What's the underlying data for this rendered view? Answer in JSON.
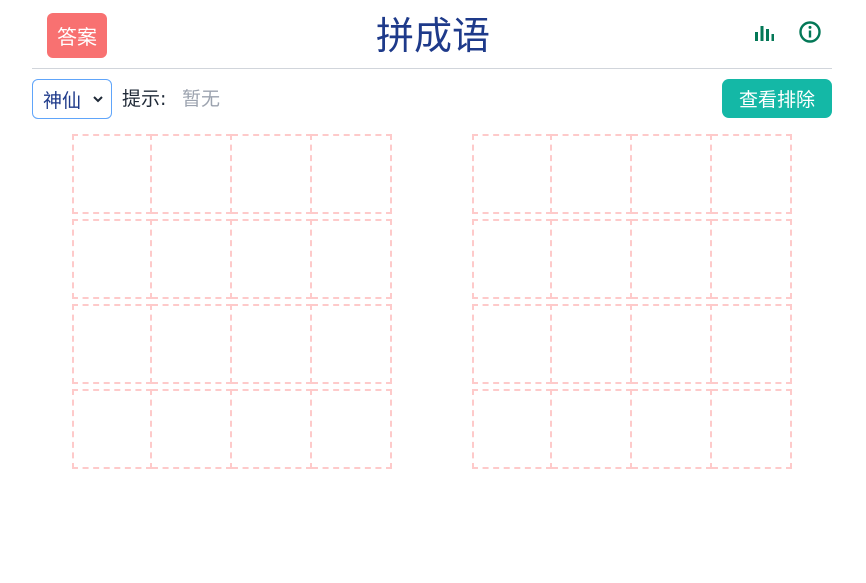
{
  "header": {
    "answer_label": "答案",
    "title": "拼成语",
    "icons": [
      "stats-icon",
      "info-icon"
    ]
  },
  "toolbar": {
    "mode_selected": "神仙",
    "hint_label": "提示:",
    "hint_value": "暂无",
    "exclude_label": "查看排除"
  },
  "colors": {
    "answer_button": "#f87171",
    "title": "#1e3a8a",
    "icon": "#047857",
    "exclude_button": "#14b8a6",
    "grid_border": "#fecaca"
  },
  "grids": {
    "count": 2,
    "rows": 4,
    "cols": 4
  }
}
